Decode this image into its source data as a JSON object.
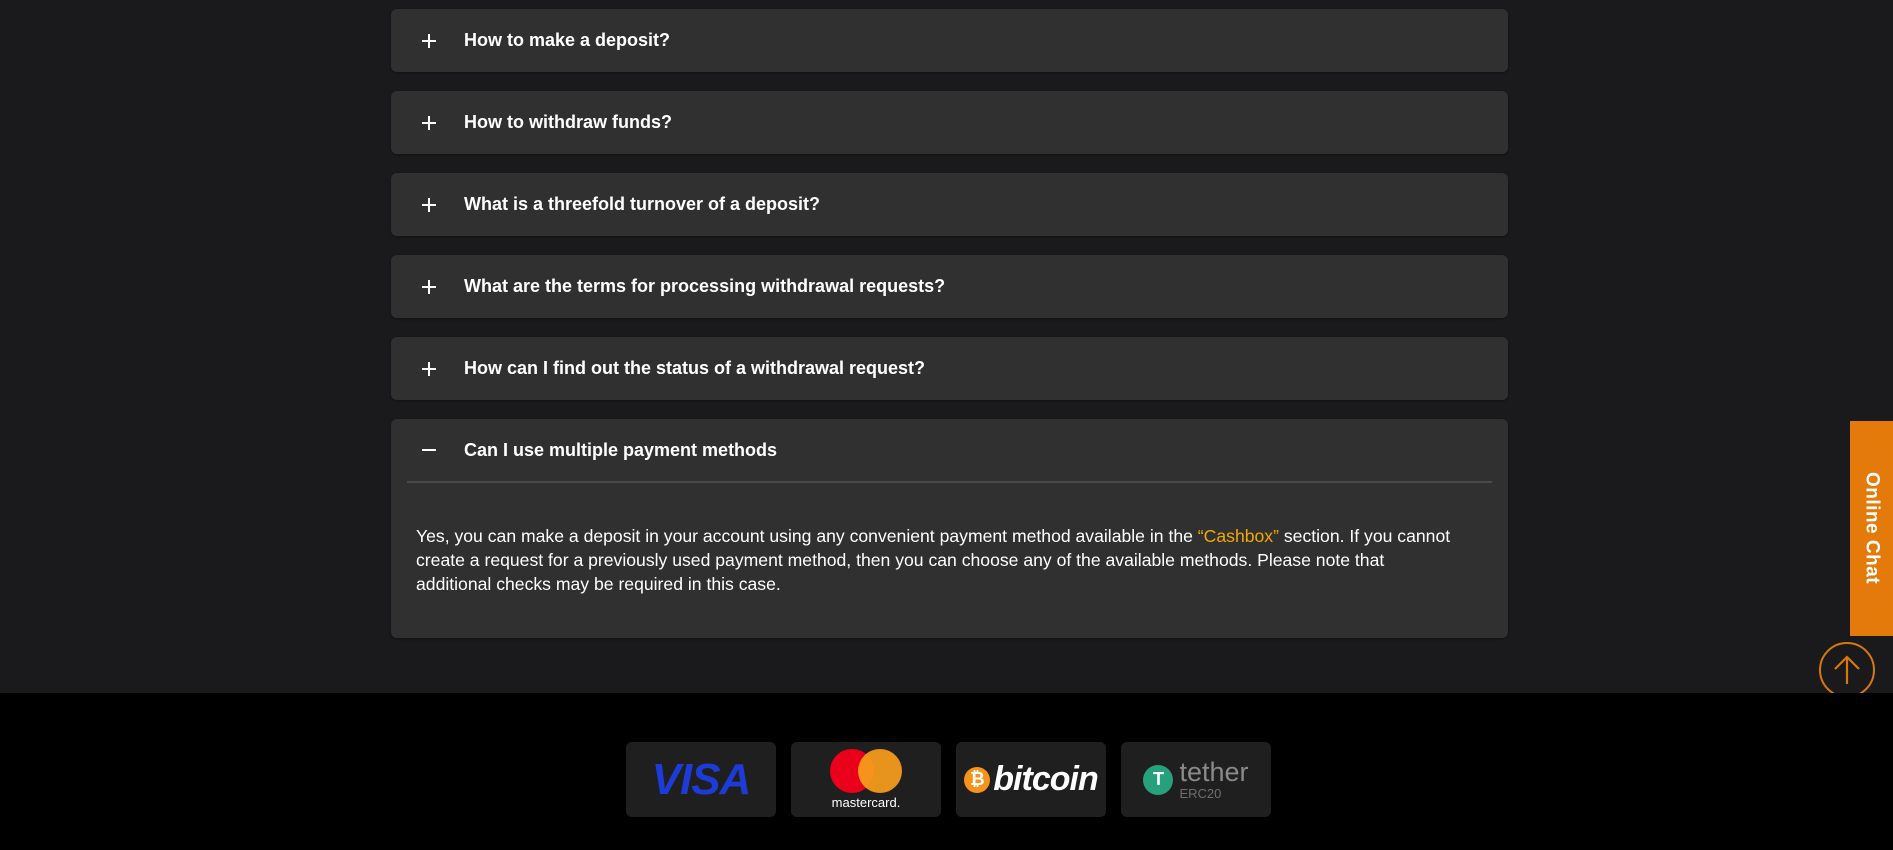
{
  "faq": {
    "items": [
      {
        "question": "How to make a deposit?"
      },
      {
        "question": "How to withdraw funds?"
      },
      {
        "question": "What is a threefold turnover of a deposit?"
      },
      {
        "question": "What are the terms for processing withdrawal requests?"
      },
      {
        "question": "How can I find out the status of a withdrawal request?"
      }
    ],
    "open_item": {
      "question": "Can I use multiple payment methods",
      "answer_part1": "Yes, you can make a deposit in your account using any convenient payment method available in the ",
      "answer_link": "“Cashbox”",
      "answer_part2": " section. If you cannot create a request for a previously used payment method, then you can choose any of the available methods. Please note that additional checks may be required in this case."
    }
  },
  "footer": {
    "payments": {
      "visa": "VISA",
      "mastercard": "mastercard.",
      "bitcoin": "bitcoin",
      "bitcoin_symbol": "₿",
      "tether": "tether",
      "tether_sub": "ERC20",
      "tether_symbol": "T"
    }
  },
  "online_chat": {
    "label": "Online Chat"
  },
  "icons": {
    "expand": "plus-icon",
    "collapse": "minus-icon",
    "scroll_top": "arrow-up-circle-icon"
  },
  "colors": {
    "accent": "#e37a0a",
    "link": "#f2a900",
    "card_bg": "#303031",
    "page_bg": "#1a1a1c",
    "footer_bg": "#000000"
  }
}
